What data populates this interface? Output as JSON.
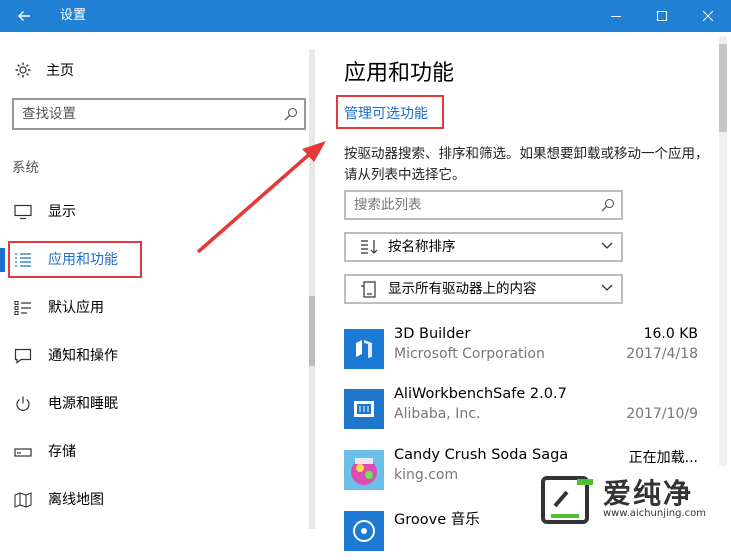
{
  "window": {
    "title": "设置"
  },
  "sidebar": {
    "home_label": "主页",
    "search_placeholder": "查找设置",
    "section_label": "系统",
    "items": [
      {
        "label": "显示",
        "icon": "monitor-icon"
      },
      {
        "label": "应用和功能",
        "icon": "list-icon"
      },
      {
        "label": "默认应用",
        "icon": "default-apps-icon"
      },
      {
        "label": "通知和操作",
        "icon": "notification-icon"
      },
      {
        "label": "电源和睡眠",
        "icon": "power-icon"
      },
      {
        "label": "存储",
        "icon": "storage-icon"
      },
      {
        "label": "离线地图",
        "icon": "map-icon"
      }
    ]
  },
  "main": {
    "title": "应用和功能",
    "manage_link": "管理可选功能",
    "description": "按驱动器搜索、排序和筛选。如果想要卸载或移动一个应用，请从列表中选择它。",
    "search_placeholder": "搜索此列表",
    "sort_label": "按名称排序",
    "drive_label": "显示所有驱动器上的内容",
    "apps": [
      {
        "name": "3D Builder",
        "publisher": "Microsoft Corporation",
        "size": "16.0 KB",
        "date": "2017/4/18",
        "tile_color": "#1c7ad4"
      },
      {
        "name": "AliWorkbenchSafe 2.0.7",
        "publisher": "Alibaba, Inc.",
        "size": "",
        "date": "2017/10/9",
        "tile_color": "#1f77cc"
      },
      {
        "name": "Candy Crush Soda Saga",
        "publisher": "king.com",
        "size": "正在加载...",
        "date": "",
        "tile_color": "#c74fb5"
      },
      {
        "name": "Groove 音乐",
        "publisher": "",
        "size": "",
        "date": "",
        "tile_color": "#1c7ad4"
      }
    ]
  },
  "watermark": {
    "name": "爱纯净",
    "url": "www.aichunjing.com"
  },
  "colors": {
    "titlebar": "#1f80d4",
    "accent": "#1f6ec9",
    "highlight": "#e23a3a"
  }
}
